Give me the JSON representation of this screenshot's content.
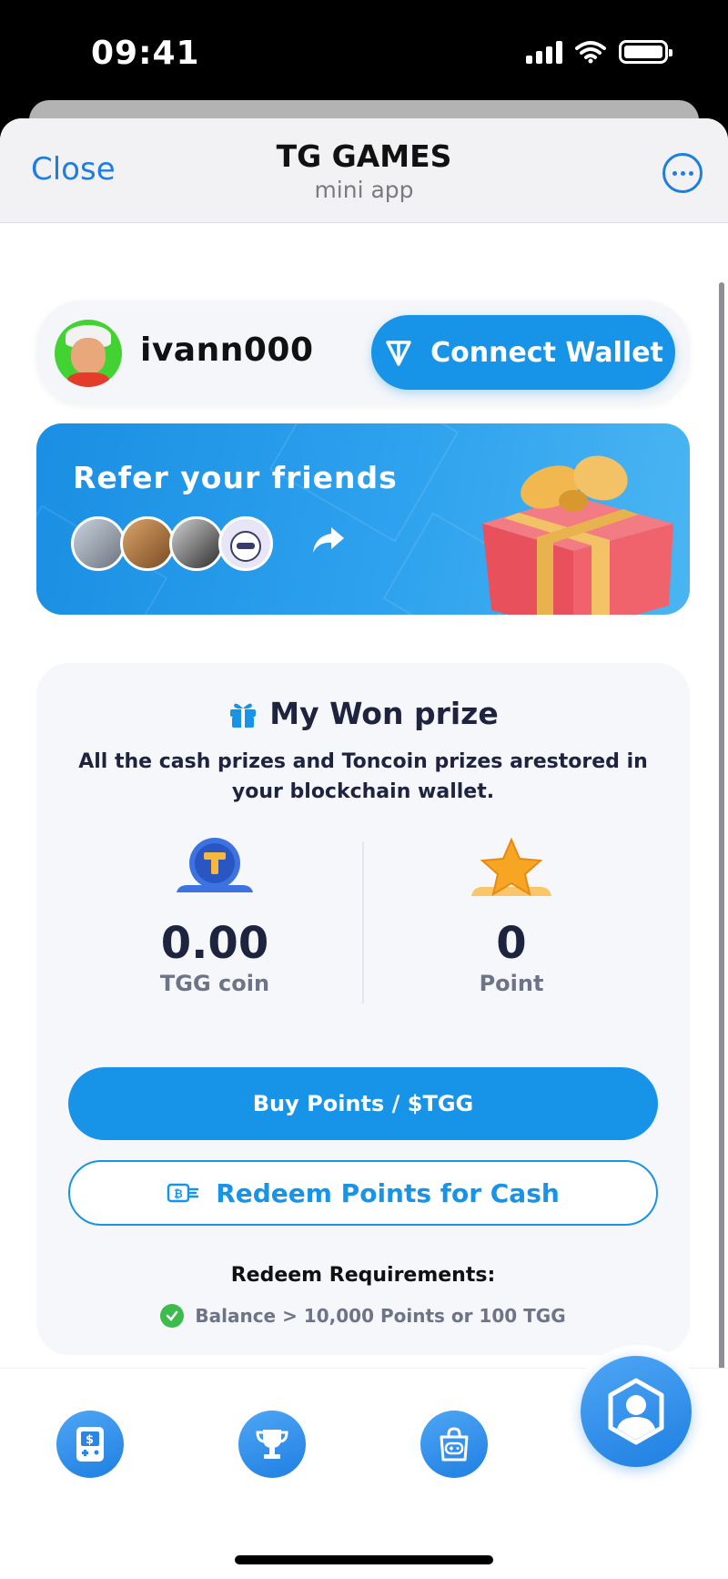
{
  "status_bar": {
    "time": "09:41",
    "icons": [
      "signal-icon",
      "wifi-icon",
      "battery-icon"
    ]
  },
  "header": {
    "close_label": "Close",
    "title": "TG GAMES",
    "subtitle": "mini app",
    "more_icon": "more-icon"
  },
  "user": {
    "username": "ivann000",
    "connect_wallet_label": "Connect Wallet"
  },
  "referral": {
    "title": "Refer your friends",
    "friend_count": 4
  },
  "prize": {
    "title": "My Won prize",
    "description": "All the cash prizes and Toncoin prizes arestored in your blockchain wallet.",
    "stats": [
      {
        "value": "0.00",
        "label": "TGG coin"
      },
      {
        "value": "0",
        "label": "Point"
      }
    ],
    "buy_label": "Buy Points / $TGG",
    "redeem_label": "Redeem Points for Cash",
    "requirements_title": "Redeem Requirements:",
    "requirement": "Balance > 10,000 Points or 100 TGG"
  },
  "nav": {
    "items": [
      "game-icon",
      "trophy-icon",
      "shop-icon",
      "profile-icon"
    ],
    "active": "profile-icon"
  },
  "colors": {
    "accent": "#1793E8",
    "text_dark": "#1E2440",
    "text_muted": "#6E7487",
    "success": "#3DBB4D"
  }
}
